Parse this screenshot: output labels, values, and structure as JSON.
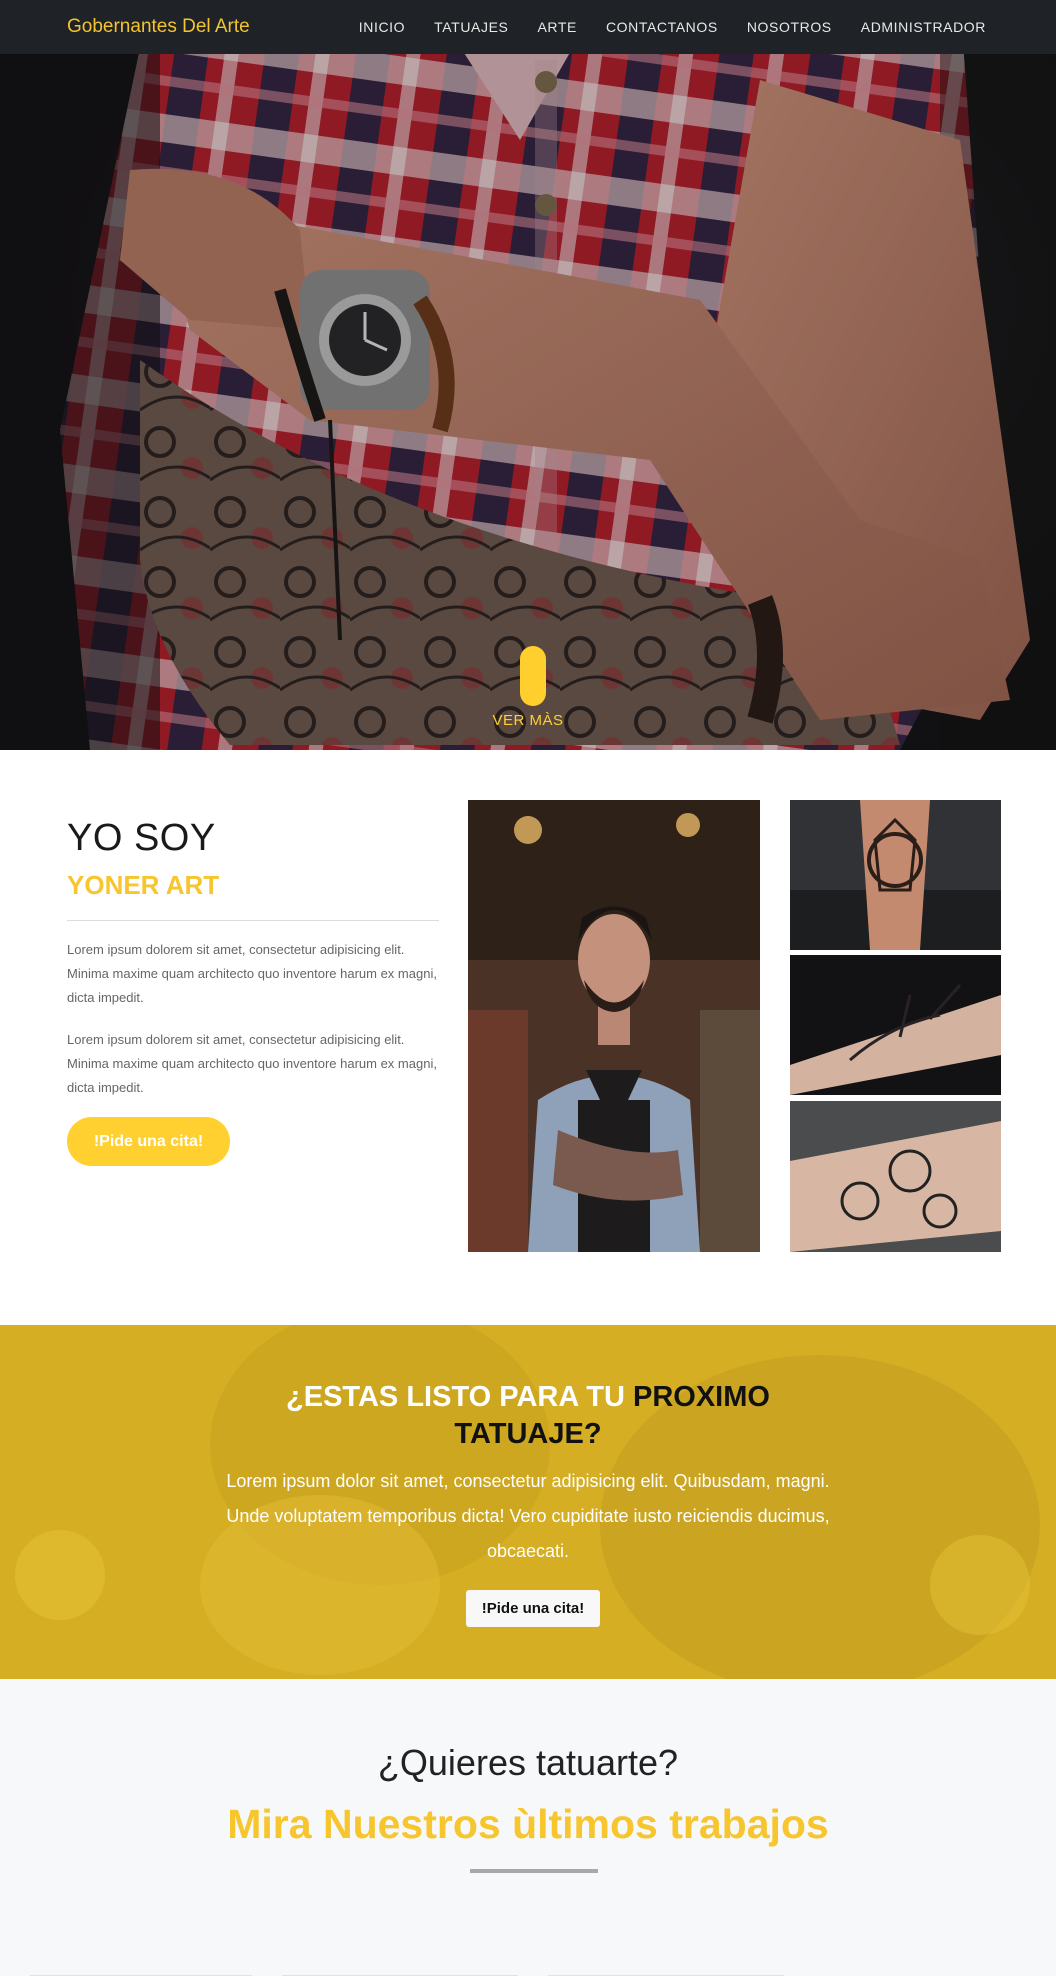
{
  "navbar": {
    "brand": "Gobernantes Del Arte",
    "items": [
      "INICIO",
      "TATUAJES",
      "ARTE",
      "CONTACTANOS",
      "NOSOTROS",
      "ADMINISTRADOR"
    ]
  },
  "hero": {
    "ver_mas": "VER MÀS"
  },
  "about": {
    "title": "YO SOY",
    "name": "YONER ART",
    "paragraph1": "Lorem ipsum dolorem sit amet, consectetur adipisicing elit. Minima maxime quam architecto quo inventore harum ex magni, dicta impedit.",
    "paragraph2": "Lorem ipsum dolorem sit amet, consectetur adipisicing elit. Minima maxime quam architecto quo inventore harum ex magni, dicta impedit.",
    "button": "!Pide una cita!"
  },
  "cta": {
    "title_light": "¿ESTAS LISTO PARA TU",
    "title_dark": "PROXIMO TATUAJE?",
    "text": "Lorem ipsum dolor sit amet, consectetur adipisicing elit. Quibusdam, magni. Unde voluptatem temporibus dicta! Vero cupiditate iusto reiciendis ducimus, obcaecati.",
    "button": "!Pide una cita!"
  },
  "works": {
    "subtitle": "¿Quieres tatuarte?",
    "title": "Mira Nuestros ùltimos trabajos"
  },
  "colors": {
    "accent": "#f7c52e",
    "navbar": "#1f2226"
  }
}
